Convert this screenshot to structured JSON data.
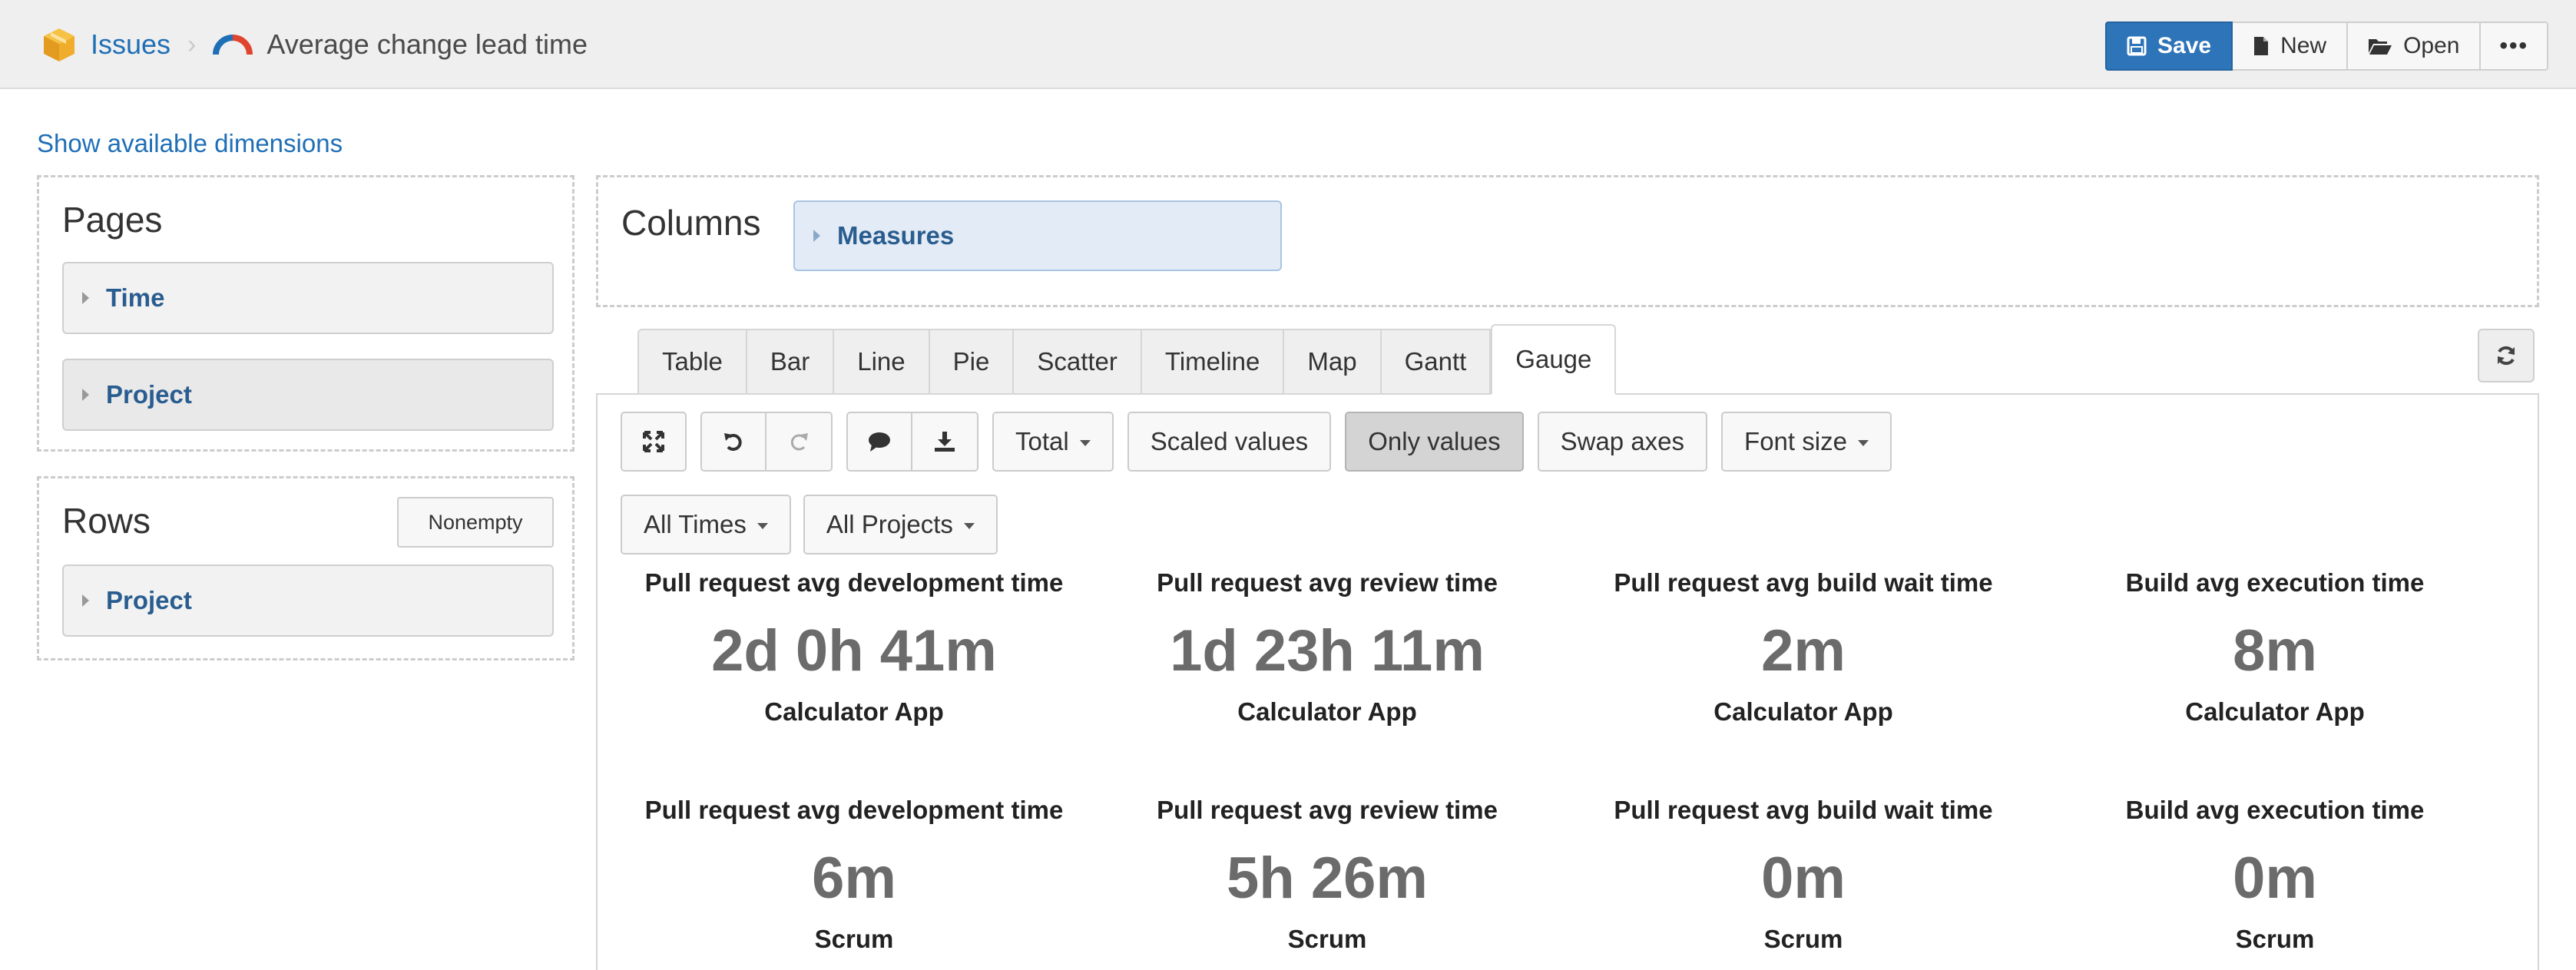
{
  "header": {
    "breadcrumb_root": "Issues",
    "breadcrumb_separator": "›",
    "report_title": "Average change lead time",
    "save_label": "Save",
    "new_label": "New",
    "open_label": "Open",
    "more_label": "•••",
    "accent_color": "#2d74b8"
  },
  "show_dimensions_link": "Show available dimensions",
  "pages": {
    "title": "Pages",
    "items": [
      "Time",
      "Project"
    ]
  },
  "rows": {
    "title": "Rows",
    "nonempty_label": "Nonempty",
    "items": [
      "Project"
    ]
  },
  "columns": {
    "title": "Columns",
    "items": [
      "Measures"
    ]
  },
  "tabs": [
    "Table",
    "Bar",
    "Line",
    "Pie",
    "Scatter",
    "Timeline",
    "Map",
    "Gantt",
    "Gauge"
  ],
  "active_tab": "Gauge",
  "toolbar": {
    "total_label": "Total",
    "scaled_values_label": "Scaled values",
    "only_values_label": "Only values",
    "swap_axes_label": "Swap axes",
    "font_size_label": "Font size"
  },
  "filters": {
    "times_label": "All Times",
    "projects_label": "All Projects"
  },
  "gauges": [
    {
      "project": "Calculator App",
      "cells": [
        {
          "measure": "Pull request avg development time",
          "value": "2d 0h 41m"
        },
        {
          "measure": "Pull request avg review time",
          "value": "1d 23h 11m"
        },
        {
          "measure": "Pull request avg build wait time",
          "value": "2m"
        },
        {
          "measure": "Build avg execution time",
          "value": "8m"
        }
      ]
    },
    {
      "project": "Scrum",
      "cells": [
        {
          "measure": "Pull request avg development time",
          "value": "6m"
        },
        {
          "measure": "Pull request avg review time",
          "value": "5h 26m"
        },
        {
          "measure": "Pull request avg build wait time",
          "value": "0m"
        },
        {
          "measure": "Build avg execution time",
          "value": "0m"
        }
      ]
    }
  ]
}
